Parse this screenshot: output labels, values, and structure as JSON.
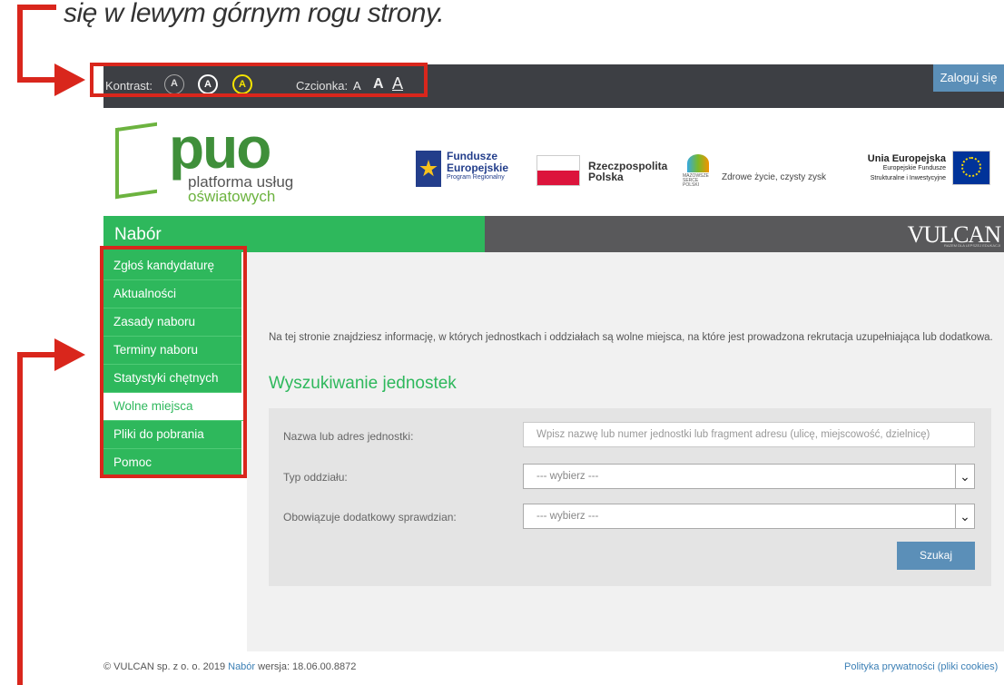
{
  "caption": "się w lewym górnym rogu strony.",
  "topbar": {
    "contrast_label": "Kontrast:",
    "contrast_options": [
      "A",
      "A",
      "A"
    ],
    "font_label": "Czcionka:",
    "font_sizes": [
      "A",
      "A",
      "A"
    ],
    "login_label": "Zaloguj się"
  },
  "logo": {
    "main": "puo",
    "line1": "platforma usług",
    "line2": "oświatowych"
  },
  "partners": {
    "fe_line1": "Fundusze",
    "fe_line2": "Europejskie",
    "fe_line3": "Program Regionalny",
    "pl_line1": "Rzeczpospolita",
    "pl_line2": "Polska",
    "ml_small": "MAZOWSZE SERCE POLSKI",
    "ml_text": "Zdrowe życie, czysty zysk",
    "eu_line1": "Unia Europejska",
    "eu_line2": "Europejskie Fundusze",
    "eu_line3": "Strukturalne i Inwestycyjne"
  },
  "nav": {
    "title": "Nabór",
    "vendor": "VULCAN",
    "vendor_sub": "RAZEM DLA LEPSZEJ EDUKACJI"
  },
  "sidebar": {
    "items": [
      "Zgłoś kandydaturę",
      "Aktualności",
      "Zasady naboru",
      "Terminy naboru",
      "Statystyki chętnych",
      "Wolne miejsca",
      "Pliki do pobrania",
      "Pomoc"
    ],
    "active_index": 5
  },
  "main": {
    "intro": "Na tej stronie znajdziesz informację, w których jednostkach i oddziałach są wolne miejsca, na które jest prowadzona rekrutacja uzupełniająca lub dodatkowa.",
    "section_title": "Wyszukiwanie jednostek",
    "form": {
      "name_label": "Nazwa lub adres jednostki:",
      "name_placeholder": "Wpisz nazwę lub numer jednostki lub fragment adresu (ulicę, miejscowość, dzielnicę)",
      "type_label": "Typ oddziału:",
      "type_value": "--- wybierz ---",
      "exam_label": "Obowiązuje dodatkowy sprawdzian:",
      "exam_value": "--- wybierz ---",
      "search_label": "Szukaj"
    }
  },
  "footer": {
    "left_pre": "© VULCAN sp. z o. o. 2019",
    "left_link": "Nabór",
    "left_post": "wersja: 18.06.00.8872",
    "right_link": "Polityka prywatności (pliki cookies)"
  },
  "colors": {
    "brand_green": "#2eb85c",
    "accent_blue": "#5b8fb8",
    "annotation_red": "#d9261c",
    "topbar_dark": "#3d3f44"
  }
}
